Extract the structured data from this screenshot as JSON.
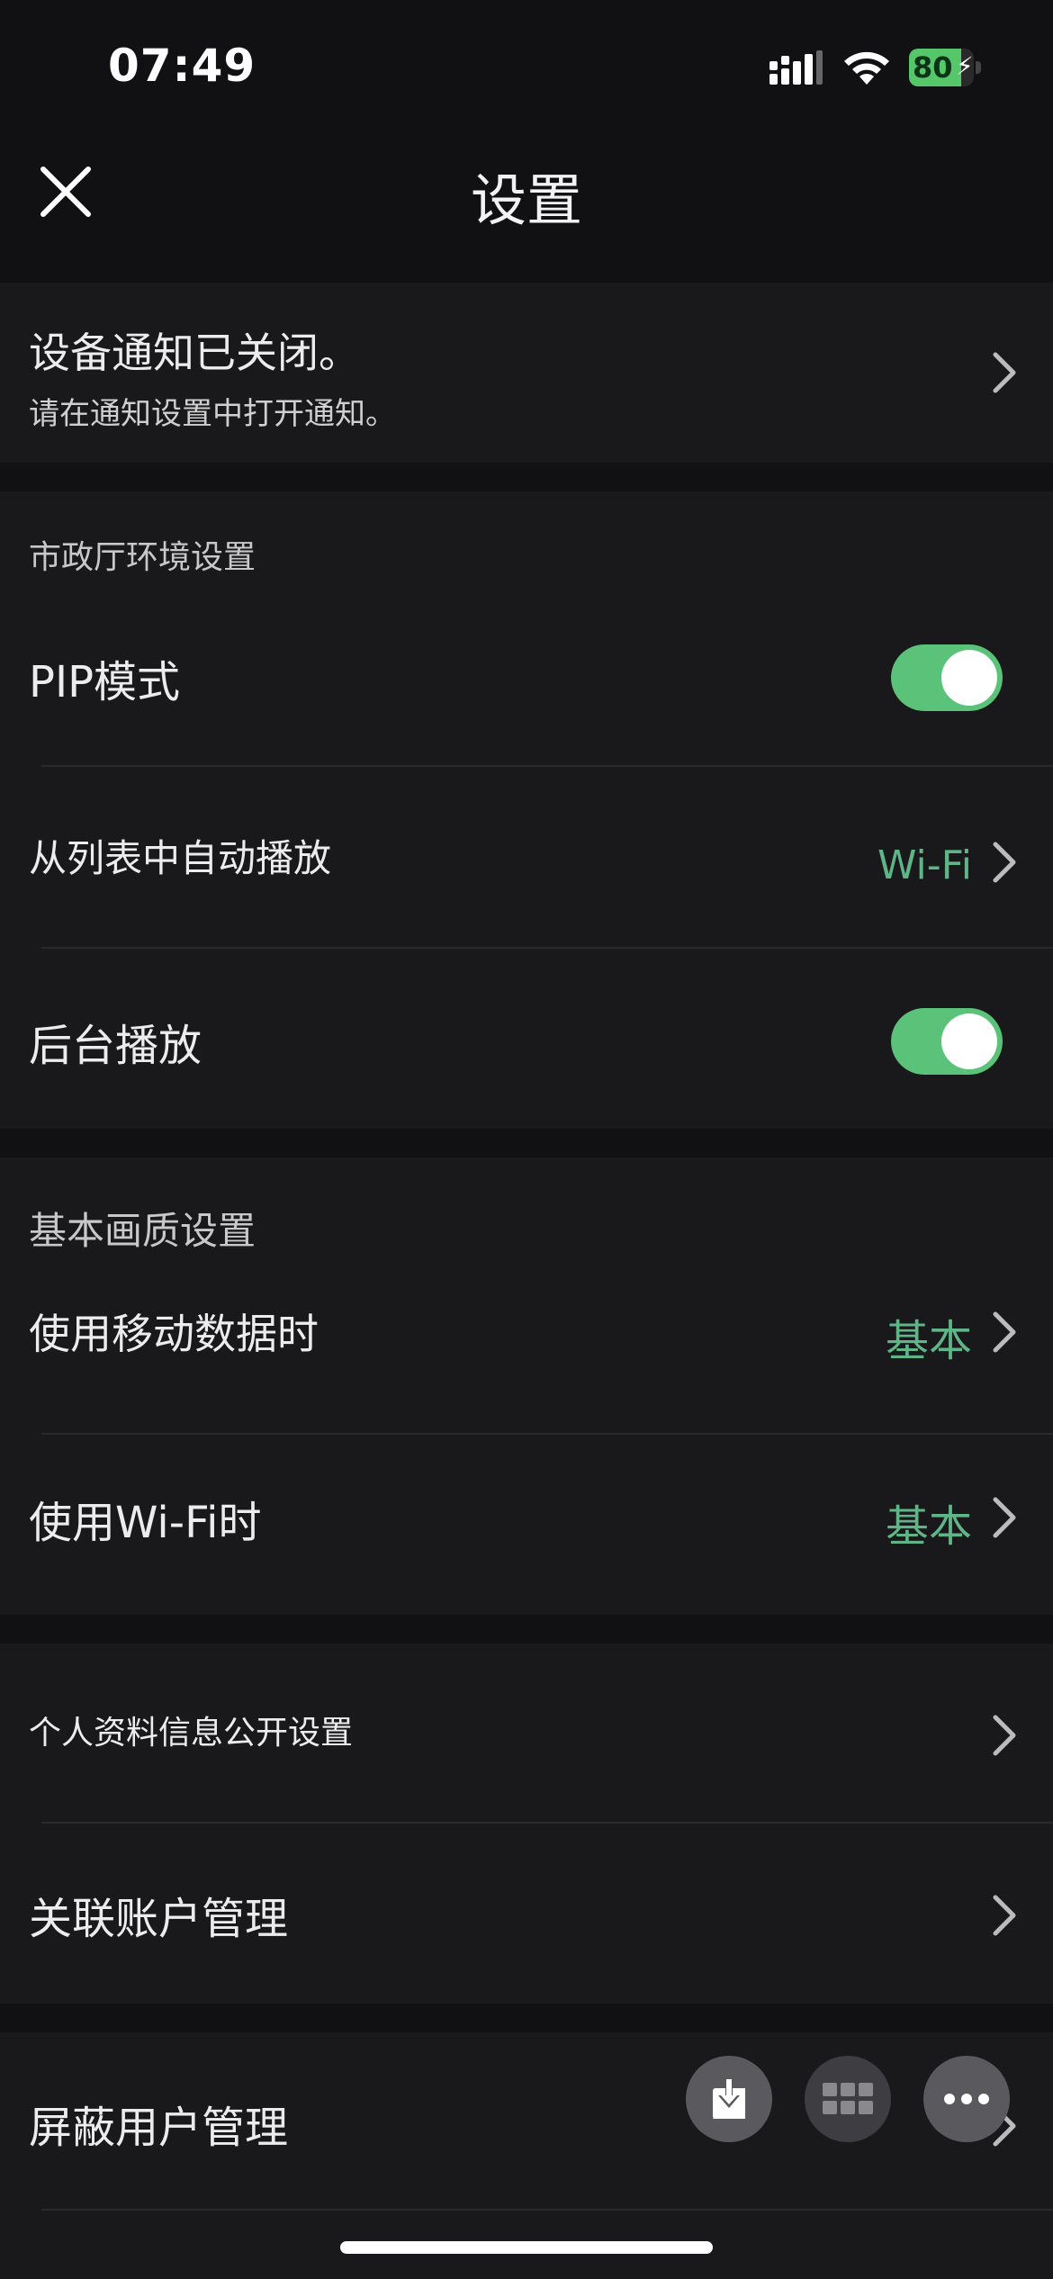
{
  "status_bar": {
    "time": "07:49",
    "battery_percent": 80,
    "battery_label": "80"
  },
  "nav": {
    "title": "设置"
  },
  "notification_banner": {
    "title": "设备通知已关闭。",
    "subtitle": "请在通知设置中打开通知。"
  },
  "section_env": {
    "header": "市政厅环境设置",
    "pip_label": "PIP模式",
    "pip_on": true,
    "autoplay_label": "从列表中自动播放",
    "autoplay_value": "Wi-Fi",
    "background_label": "后台播放",
    "background_on": true
  },
  "section_quality": {
    "header": "基本画质设置",
    "mobile_label": "使用移动数据时",
    "mobile_value": "基本",
    "wifi_label": "使用Wi-Fi时",
    "wifi_value": "基本"
  },
  "section_account": {
    "profile_label": "个人资料信息公开设置",
    "linked_label": "关联账户管理"
  },
  "section_block": {
    "block_label": "屏蔽用户管理"
  },
  "colors": {
    "accent_green": "#5bc279",
    "value_green": "#5fb587",
    "section_bg": "#19191b",
    "page_bg": "#111113"
  },
  "icons": [
    "close-icon",
    "chevron-right-icon",
    "download-icon",
    "grid-icon",
    "more-icon",
    "wifi-icon",
    "signal-icon",
    "battery-icon"
  ]
}
